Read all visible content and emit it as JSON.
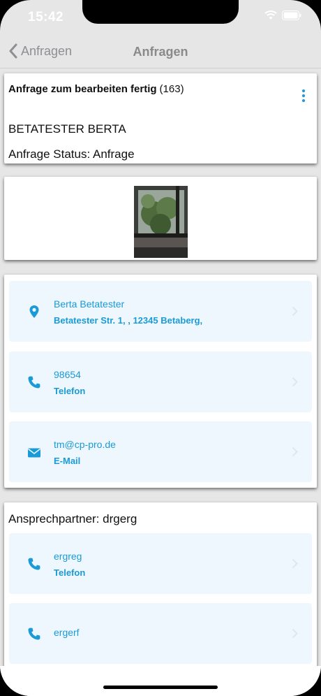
{
  "status_bar": {
    "time": "15:42"
  },
  "nav": {
    "back_label": "Anfragen",
    "title": "Anfragen"
  },
  "request": {
    "title": "Anfrage zum bearbeiten fertig",
    "count": "(163)",
    "customer": "BETATESTER BERTA",
    "status_label": "Anfrage Status:",
    "status_value": "Anfrage"
  },
  "contact": {
    "address": {
      "name": "Berta Betatester",
      "street": "Betatester Str. 1, , 12345 Betaberg,"
    },
    "phone": {
      "number": "98654",
      "label": "Telefon"
    },
    "email": {
      "address": "tm@cp-pro.de",
      "label": "E-Mail"
    }
  },
  "partner": {
    "label": "Ansprechpartner:",
    "name": "drgerg",
    "items": [
      {
        "value": "ergreg",
        "label": "Telefon"
      },
      {
        "value": "ergerf",
        "label": ""
      }
    ]
  },
  "colors": {
    "accent": "#1a9ad6",
    "row_bg": "#eef7fd",
    "nav_bg": "#e6e6e6"
  },
  "icons": [
    "chevron-left-icon",
    "more-vertical-icon",
    "location-pin-icon",
    "phone-icon",
    "mail-icon",
    "chevron-right-icon",
    "wifi-icon",
    "battery-icon",
    "signal-icon"
  ]
}
